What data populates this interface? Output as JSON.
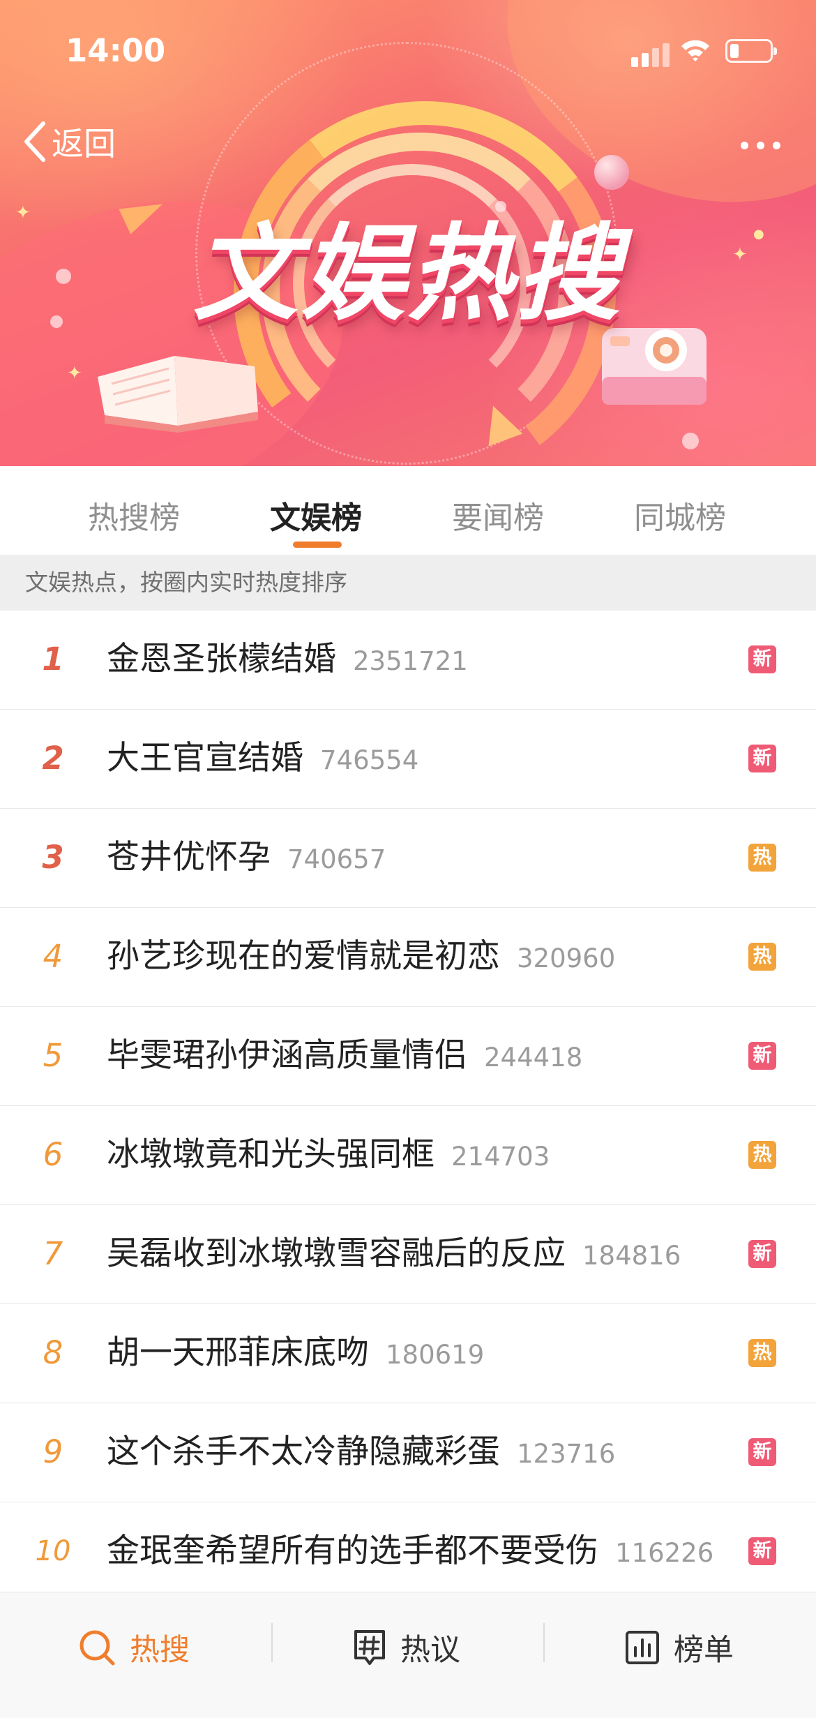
{
  "status_bar": {
    "time": "14:00"
  },
  "header": {
    "back_label": "返回",
    "banner_title": "文娱热搜"
  },
  "tabs": [
    {
      "label": "热搜榜",
      "active": false
    },
    {
      "label": "文娱榜",
      "active": true
    },
    {
      "label": "要闻榜",
      "active": false
    },
    {
      "label": "同城榜",
      "active": false
    }
  ],
  "subheader": "文娱热点，按圈内实时热度排序",
  "list": [
    {
      "rank": "1",
      "title": "金恩圣张檬结婚",
      "count": "2351721",
      "badge": "新",
      "badge_type": "new"
    },
    {
      "rank": "2",
      "title": "大王官宣结婚",
      "count": "746554",
      "badge": "新",
      "badge_type": "new"
    },
    {
      "rank": "3",
      "title": "苍井优怀孕",
      "count": "740657",
      "badge": "热",
      "badge_type": "hot"
    },
    {
      "rank": "4",
      "title": "孙艺珍现在的爱情就是初恋",
      "count": "320960",
      "badge": "热",
      "badge_type": "hot"
    },
    {
      "rank": "5",
      "title": "毕雯珺孙伊涵高质量情侣",
      "count": "244418",
      "badge": "新",
      "badge_type": "new"
    },
    {
      "rank": "6",
      "title": "冰墩墩竟和光头强同框",
      "count": "214703",
      "badge": "热",
      "badge_type": "hot"
    },
    {
      "rank": "7",
      "title": "吴磊收到冰墩墩雪容融后的反应",
      "count": "184816",
      "badge": "新",
      "badge_type": "new"
    },
    {
      "rank": "8",
      "title": "胡一天邢菲床底吻",
      "count": "180619",
      "badge": "热",
      "badge_type": "hot"
    },
    {
      "rank": "9",
      "title": "这个杀手不太冷静隐藏彩蛋",
      "count": "123716",
      "badge": "新",
      "badge_type": "new"
    },
    {
      "rank": "10",
      "title": "金珉奎希望所有的选手都不要受伤",
      "count": "116226",
      "badge": "新",
      "badge_type": "new"
    }
  ],
  "bottom_nav": [
    {
      "label": "热搜",
      "icon": "search-icon",
      "active": true
    },
    {
      "label": "热议",
      "icon": "hashtag-icon",
      "active": false
    },
    {
      "label": "榜单",
      "icon": "chart-icon",
      "active": false
    }
  ],
  "colors": {
    "accent": "#f07d2c",
    "badge_new": "#ef5a75",
    "badge_hot": "#f2a33a",
    "rank_top": "#e0604a",
    "rank_other": "#f0993a"
  }
}
